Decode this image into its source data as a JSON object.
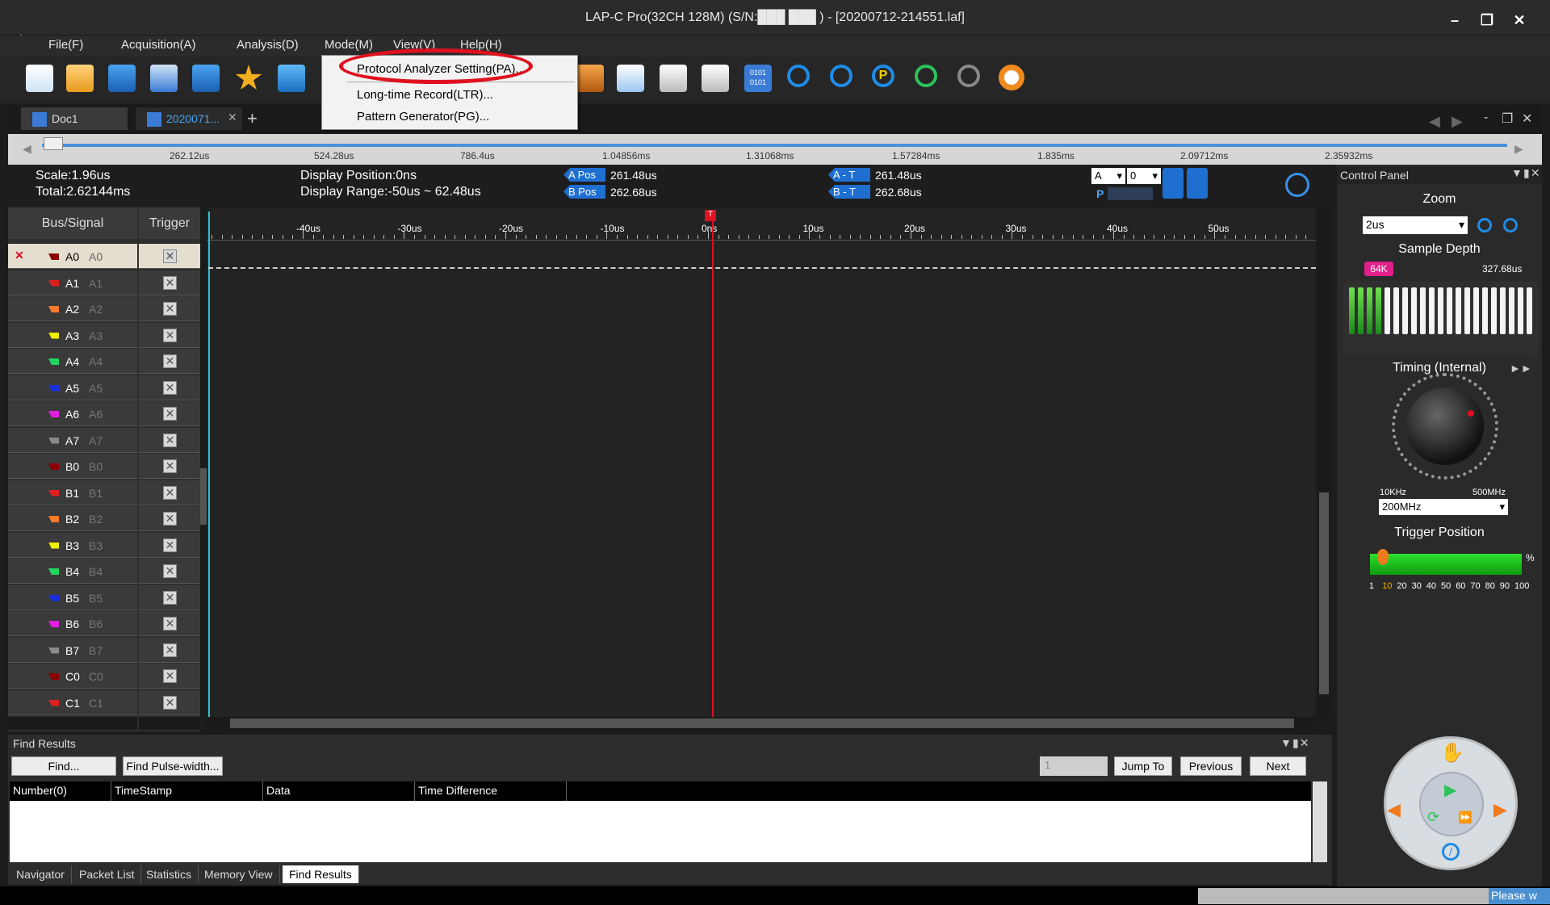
{
  "window": {
    "title": "LAP-C Pro(32CH 128M) (S/N:███ ███ ) - [20200712-214551.laf]"
  },
  "menu": {
    "file": "File(F)",
    "acquisition": "Acquisition(A)",
    "analysis": "Analysis(D)",
    "mode": "Mode(M)",
    "view": "View(V)",
    "help": "Help(H)"
  },
  "mode_dropdown": {
    "items": [
      "Protocol Analyzer Setting(PA)...",
      "Long-time Record(LTR)...",
      "Pattern Generator(PG)..."
    ]
  },
  "tabs": {
    "doc1": "Doc1",
    "doc2": "2020071...",
    "add": "+"
  },
  "ruler": {
    "labels": [
      "262.12us",
      "524.28us",
      "786.4us",
      "1.04856ms",
      "1.31068ms",
      "1.57284ms",
      "1.835ms",
      "2.09712ms",
      "2.35932ms"
    ]
  },
  "info": {
    "scale": "Scale:1.96us",
    "total": "Total:2.62144ms",
    "display_position": "Display Position:0ns",
    "display_range": "Display Range:-50us ~ 62.48us",
    "a_pos_label": "A Pos",
    "a_pos_value": "261.48us",
    "b_pos_label": "B Pos",
    "b_pos_value": "262.68us",
    "a_t_label": "A - T",
    "a_t_value": "261.48us",
    "b_t_label": "B - T",
    "b_t_value": "262.68us",
    "cursor_select": "A",
    "cursor_num": "0",
    "p_label": "P"
  },
  "signal_panel": {
    "bus_header": "Bus/Signal",
    "trigger_header": "Trigger",
    "signals": [
      {
        "name": "A0",
        "alias": "A0",
        "color": "#8b0000"
      },
      {
        "name": "A1",
        "alias": "A1",
        "color": "#e0201e"
      },
      {
        "name": "A2",
        "alias": "A2",
        "color": "#ff7a2a"
      },
      {
        "name": "A3",
        "alias": "A3",
        "color": "#f0f000"
      },
      {
        "name": "A4",
        "alias": "A4",
        "color": "#1ed760"
      },
      {
        "name": "A5",
        "alias": "A5",
        "color": "#1a2fe0"
      },
      {
        "name": "A6",
        "alias": "A6",
        "color": "#e020e0"
      },
      {
        "name": "A7",
        "alias": "A7",
        "color": "#8a8a8a"
      },
      {
        "name": "B0",
        "alias": "B0",
        "color": "#8b0000"
      },
      {
        "name": "B1",
        "alias": "B1",
        "color": "#e0201e"
      },
      {
        "name": "B2",
        "alias": "B2",
        "color": "#ff7a2a"
      },
      {
        "name": "B3",
        "alias": "B3",
        "color": "#f0f000"
      },
      {
        "name": "B4",
        "alias": "B4",
        "color": "#1ed760"
      },
      {
        "name": "B5",
        "alias": "B5",
        "color": "#1a2fe0"
      },
      {
        "name": "B6",
        "alias": "B6",
        "color": "#e020e0"
      },
      {
        "name": "B7",
        "alias": "B7",
        "color": "#8a8a8a"
      },
      {
        "name": "C0",
        "alias": "C0",
        "color": "#8b0000"
      },
      {
        "name": "C1",
        "alias": "C1",
        "color": "#e0201e"
      }
    ]
  },
  "time_axis": {
    "labels": [
      "-40us",
      "-30us",
      "-20us",
      "-10us",
      "0ns",
      "10us",
      "20us",
      "30us",
      "40us",
      "50us"
    ],
    "trigger_marker": "T"
  },
  "control_panel": {
    "title": "Control Panel",
    "zoom_label": "Zoom",
    "zoom_value": "2us",
    "sample_depth_label": "Sample Depth",
    "depth_badge": "64K",
    "depth_time": "327.68us",
    "timing_label": "Timing (Internal)",
    "freq_min": "10KHz",
    "freq_max": "500MHz",
    "freq_value": "200MHz",
    "trigger_position_label": "Trigger Position",
    "trigger_position_ticks": [
      "1",
      "10",
      "20",
      "30",
      "40",
      "50",
      "60",
      "70",
      "80",
      "90",
      "100"
    ],
    "trigger_position_unit": "%",
    "trigger_position_value": 10
  },
  "find_results": {
    "title": "Find Results",
    "find_btn": "Find...",
    "find_pulse_btn": "Find Pulse-width...",
    "jump_value": "1",
    "jump_btn": "Jump To",
    "prev_btn": "Previous",
    "next_btn": "Next",
    "columns": [
      "Number(0)",
      "TimeStamp",
      "Data",
      "Time Difference"
    ]
  },
  "bottom_tabs": [
    "Navigator",
    "Packet List",
    "Statistics",
    "Memory View",
    "Find Results"
  ],
  "status": {
    "text": "Please w"
  },
  "colors": {
    "highlight_circle": "#e0101e",
    "cursor_a": "#1f6fd1",
    "trigger_line": "#e0101e"
  }
}
